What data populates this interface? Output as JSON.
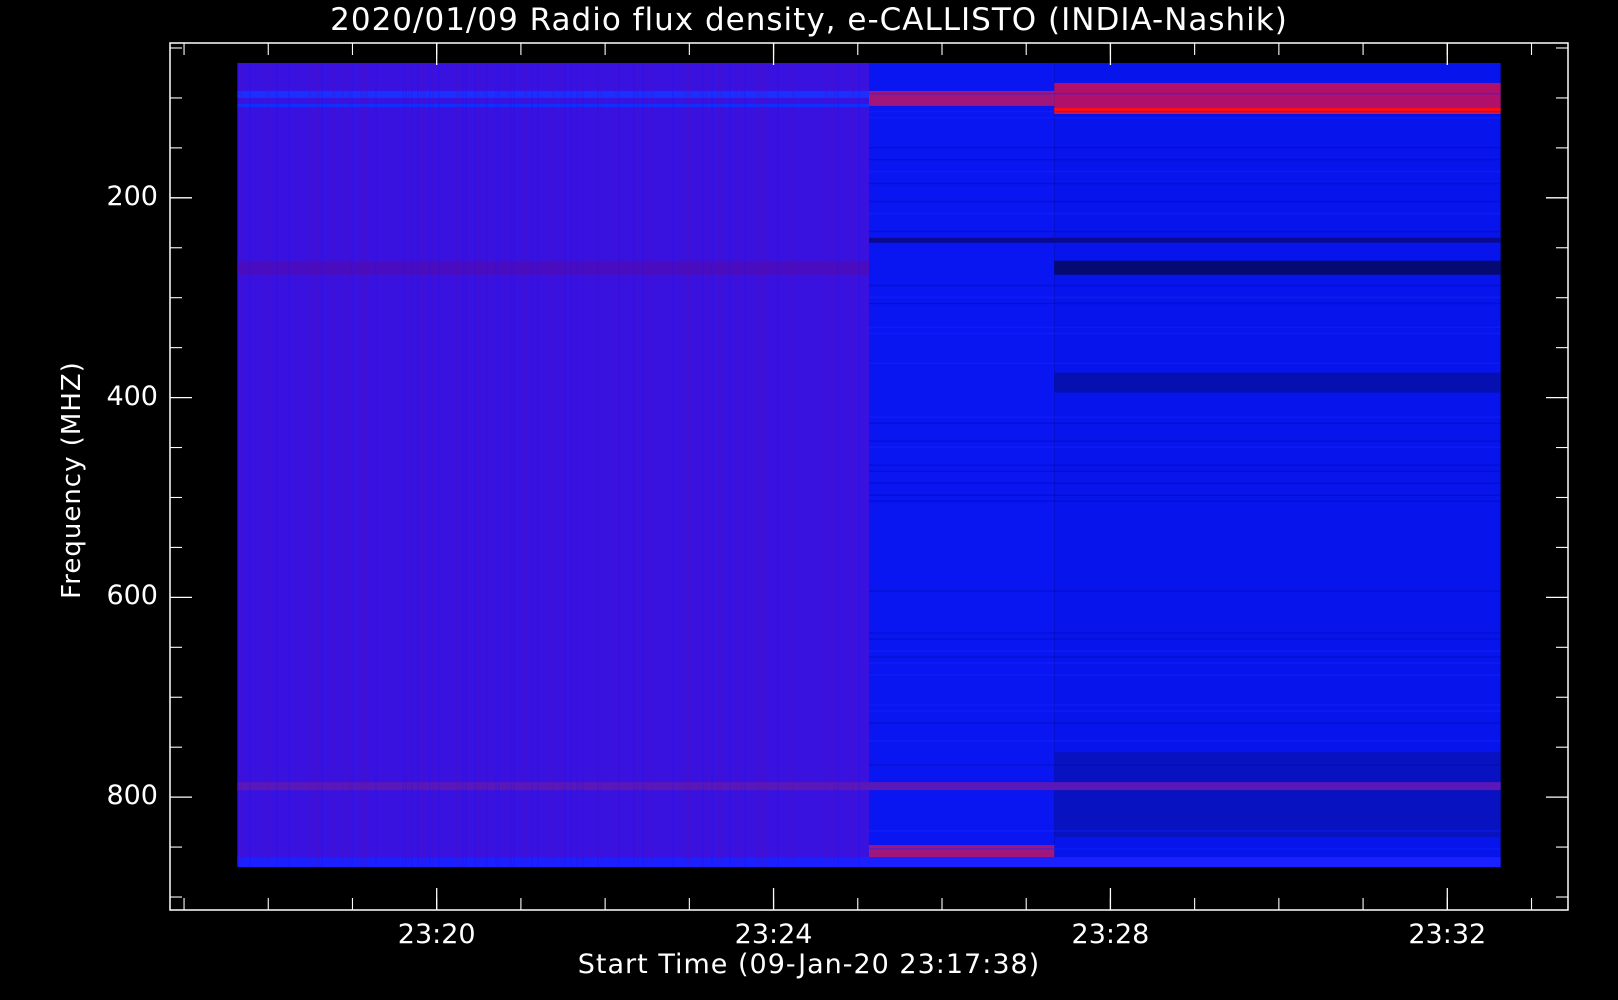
{
  "chart_data": {
    "type": "heatmap",
    "title": "2020/01/09  Radio flux density, e-CALLISTO (INDIA-Nashik)",
    "xlabel": "Start Time (09-Jan-20 23:17:38)",
    "ylabel": "Frequency (MHZ)",
    "x_tick_labels": [
      "23:20",
      "23:24",
      "23:28",
      "23:32"
    ],
    "x_tick_values_min": [
      2.3667,
      6.3667,
      10.3667,
      14.3667
    ],
    "y_tick_labels": [
      "200",
      "400",
      "600",
      "800"
    ],
    "y_tick_values": [
      200,
      400,
      600,
      800
    ],
    "xlim_min_since_start": [
      -0.8,
      15.8
    ],
    "data_x_range_min_since_start": [
      0,
      15.0
    ],
    "ylim": [
      45,
      913
    ],
    "y_inverted": true,
    "data_y_range": [
      65,
      870
    ],
    "colors": {
      "background": "#000000",
      "axes": "#ffffff",
      "segment_1": "#3a12e0",
      "segment_2": "#0a16f2",
      "segment_3": "#0814ec",
      "hot": "#ff1010"
    },
    "segments": [
      {
        "t_start": 0.0,
        "t_end": 7.5,
        "level": "medium",
        "color": "#3a12e0"
      },
      {
        "t_start": 7.5,
        "t_end": 9.7,
        "level": "low",
        "color": "#0a16f2"
      },
      {
        "t_start": 9.7,
        "t_end": 15.0,
        "level": "low",
        "color": "#0814ec"
      }
    ],
    "bands": [
      {
        "freq_min": 93,
        "freq_max": 100,
        "t_start": 0.0,
        "t_end": 7.5,
        "color": "#1a30ff"
      },
      {
        "freq_min": 106,
        "freq_max": 109,
        "t_start": 0.0,
        "t_end": 7.5,
        "color": "#1030ff"
      },
      {
        "freq_min": 93,
        "freq_max": 108,
        "t_start": 7.5,
        "t_end": 9.7,
        "color": "#a0167a"
      },
      {
        "freq_min": 85,
        "freq_max": 113,
        "t_start": 9.7,
        "t_end": 15.0,
        "color": "#b0106a"
      },
      {
        "freq_min": 110,
        "freq_max": 116,
        "t_start": 9.7,
        "t_end": 15.0,
        "color": "#ff1010"
      },
      {
        "freq_min": 240,
        "freq_max": 245,
        "t_start": 7.5,
        "t_end": 15.0,
        "color": "#0a0a90"
      },
      {
        "freq_min": 263,
        "freq_max": 277,
        "t_start": 9.7,
        "t_end": 15.0,
        "color": "#050a70"
      },
      {
        "freq_min": 263,
        "freq_max": 277,
        "t_start": 0.0,
        "t_end": 7.5,
        "color": "#4a0cc0"
      },
      {
        "freq_min": 375,
        "freq_max": 395,
        "t_start": 9.7,
        "t_end": 15.0,
        "color": "#0610b0"
      },
      {
        "freq_min": 755,
        "freq_max": 840,
        "t_start": 9.7,
        "t_end": 15.0,
        "color": "#0812c0"
      },
      {
        "freq_min": 785,
        "freq_max": 793,
        "t_start": 0.0,
        "t_end": 15.0,
        "color": "#5a18b8"
      },
      {
        "freq_min": 848,
        "freq_max": 862,
        "t_start": 7.5,
        "t_end": 9.7,
        "color": "#a0167a"
      },
      {
        "freq_min": 860,
        "freq_max": 870,
        "t_start": 0.0,
        "t_end": 15.0,
        "color": "#1a20ff"
      }
    ]
  }
}
